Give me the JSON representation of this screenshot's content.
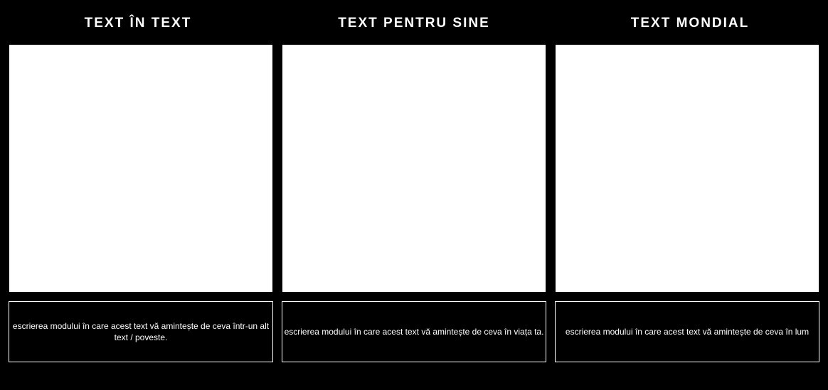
{
  "columns": [
    {
      "title": "TEXT ÎN TEXT",
      "description": "escrierea modului în care acest text vă amintește de ceva într-un alt text / poveste."
    },
    {
      "title": "TEXT PENTRU SINE",
      "description": "escrierea modului în care acest text vă amintește de ceva în viața ta."
    },
    {
      "title": "TEXT MONDIAL",
      "description": "escrierea modului în care acest text vă amintește de ceva în lum"
    }
  ]
}
